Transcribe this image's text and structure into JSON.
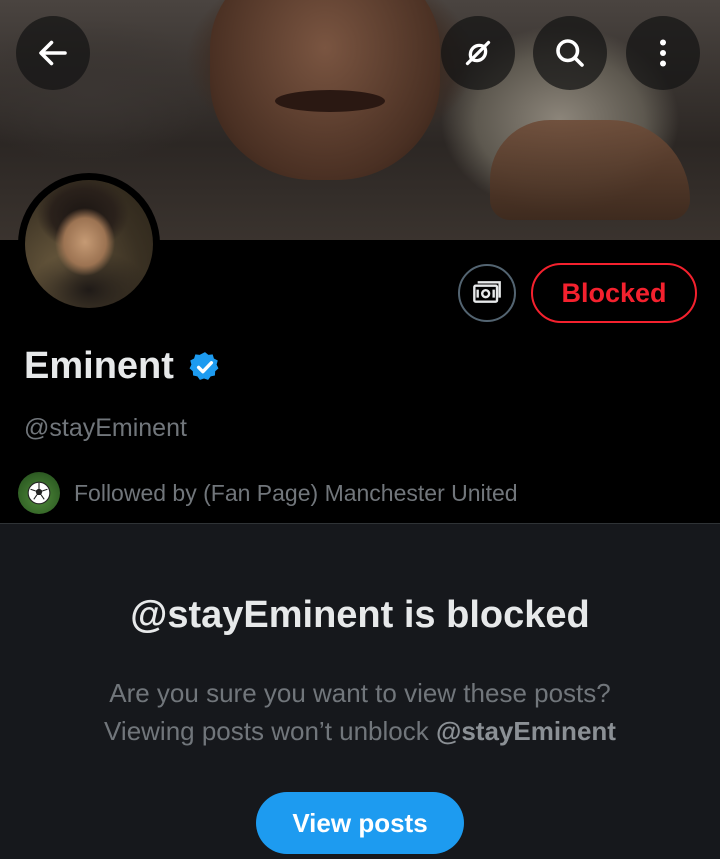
{
  "header": {
    "back_icon": "arrow-left-icon",
    "grok_icon": "grok-slash-icon",
    "search_icon": "search-icon",
    "more_icon": "more-vertical-icon"
  },
  "profile": {
    "name": "Eminent",
    "handle": "@stayEminent",
    "verified": true,
    "verified_color": "#1d9bf0",
    "blocked_label": "Blocked",
    "blocked_color": "#f4212e",
    "subscribe_icon": "money-icon",
    "followed_by": "Followed by (Fan Page) Manchester United"
  },
  "blocked_notice": {
    "title": "@stayEminent is blocked",
    "line1": "Are you sure you want to view these posts?",
    "line2_prefix": "Viewing posts won’t unblock ",
    "line2_handle": "@stayEminent",
    "button_label": "View posts",
    "button_color": "#1d9bf0"
  }
}
